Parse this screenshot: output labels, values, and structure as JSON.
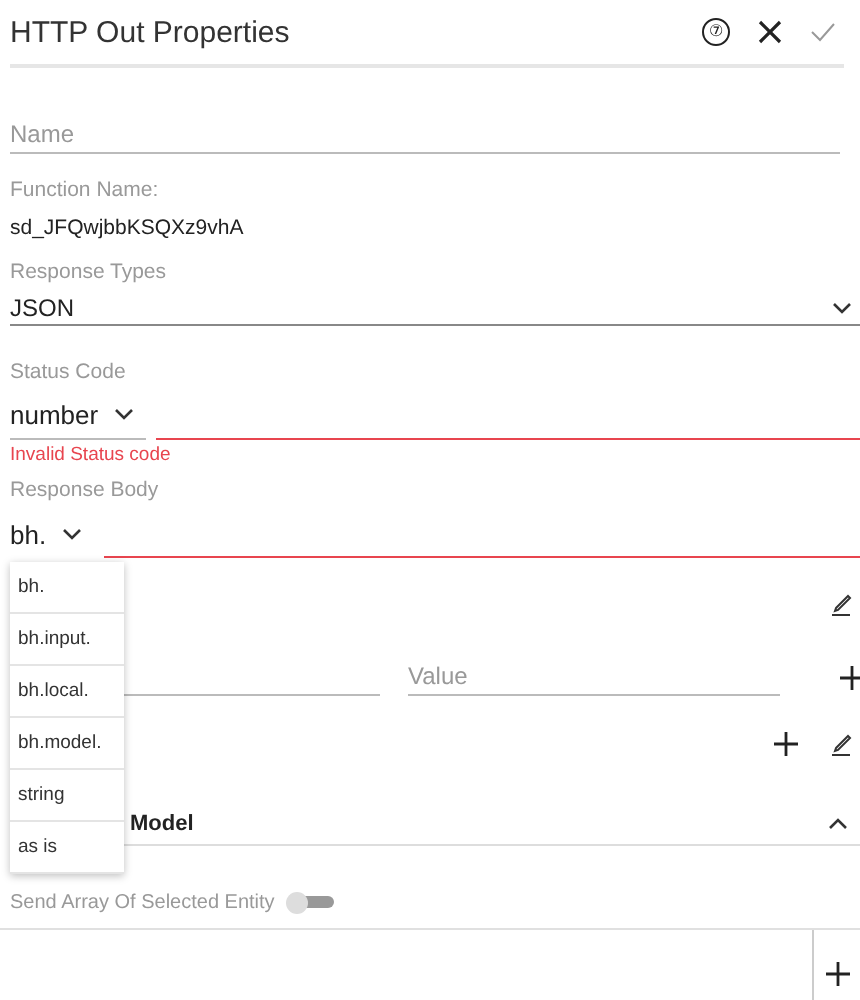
{
  "header": {
    "title": "HTTP Out Properties",
    "help_icon": "⑦"
  },
  "name_field": {
    "placeholder": "Name"
  },
  "function_name": {
    "label": "Function Name:",
    "value": "sd_JFQwjbbKSQXz9vhA"
  },
  "response_types": {
    "label": "Response Types",
    "value": "JSON"
  },
  "status_code": {
    "label": "Status Code",
    "type": "number",
    "error": "Invalid Status code",
    "invalid": true
  },
  "response_body": {
    "label": "Response Body",
    "type": "bh.",
    "invalid": true
  },
  "type_menu": {
    "items": [
      {
        "label": "bh."
      },
      {
        "label": "bh.input."
      },
      {
        "label": "bh.local."
      },
      {
        "label": "bh.model."
      },
      {
        "label": "string"
      },
      {
        "label": "as is"
      }
    ]
  },
  "headers": {
    "value_placeholder": "Value"
  },
  "section": {
    "title": "Model",
    "expanded": true
  },
  "toggle": {
    "label": "Send Array Of Selected Entity",
    "on": false
  }
}
